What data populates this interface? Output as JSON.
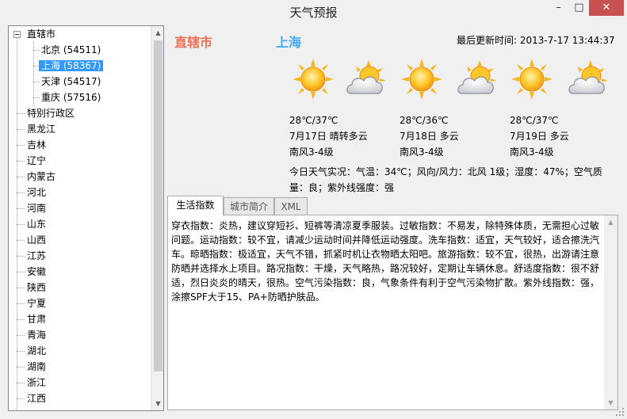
{
  "window": {
    "title": "天气预报"
  },
  "tree": {
    "root": "直辖市",
    "children": [
      "北京 (54511)",
      "上海 (58367)",
      "天津 (54517)",
      "重庆 (57516)"
    ],
    "selected_index": 1,
    "provinces": [
      "特别行政区",
      "黑龙江",
      "吉林",
      "辽宁",
      "内蒙古",
      "河北",
      "河南",
      "山东",
      "山西",
      "江苏",
      "安徽",
      "陕西",
      "宁夏",
      "甘肃",
      "青海",
      "湖北",
      "湖南",
      "浙江",
      "江西"
    ]
  },
  "header": {
    "region": "直辖市",
    "city": "上海",
    "update_label": "最后更新时间: 2013-7-17 13:44:37"
  },
  "forecast": [
    {
      "temp": "28℃/37℃",
      "date": "7月17日 晴转多云",
      "wind": "南风3-4级"
    },
    {
      "temp": "28℃/36℃",
      "date": "7月18日 多云",
      "wind": "南风3-4级"
    },
    {
      "temp": "28℃/37℃",
      "date": "7月19日 多云",
      "wind": "南风3-4级"
    }
  ],
  "icons": [
    "sun-icon",
    "cloudy-icon",
    "sun-icon",
    "cloudy-icon",
    "sun-icon",
    "cloudy-icon"
  ],
  "today_weather": "今日天气实况：气温：34℃；风向/风力：北风 1级；湿度：47%；空气质量：良；紫外线强度：强",
  "tabs": [
    "生活指数",
    "城市简介",
    "XML"
  ],
  "active_tab": 0,
  "life_index": "穿衣指数：炎热，建议穿短衫、短裤等清凉夏季服装。过敏指数：不易发，除特殊体质，无需担心过敏问题。运动指数：较不宜，请减少运动时间并降低运动强度。洗车指数：适宜，天气较好，适合擦洗汽车。晾晒指数：极适宜，天气不错，抓紧时机让衣物晒太阳吧。旅游指数：较不宜，很热，出游请注意防晒并选择水上项目。路况指数：干燥，天气略热，路况较好，定期让车辆休息。舒适度指数：很不舒适，烈日炎炎的晴天，很热。空气污染指数：良，气象条件有利于空气污染物扩散。紫外线指数：强，涂擦SPF大于15、PA+防晒护肤品。",
  "colors": {
    "region": "#f07055",
    "city": "#3fa9f5",
    "selection": "#3399ff",
    "close": "#c75050"
  }
}
